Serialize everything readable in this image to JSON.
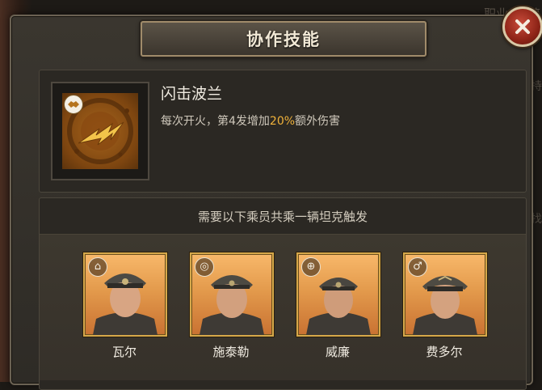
{
  "background": {
    "right_text_1": "职业: 装填",
    "right_text_2": "持",
    "right_text_3": "找"
  },
  "dialog": {
    "title": "协作技能",
    "close_icon": "close-icon"
  },
  "skill": {
    "icon": "lightning-shell-skill-icon",
    "badge_icon": "handshake-icon",
    "name": "闪击波兰",
    "desc_prefix": "每次开火，第4发增加",
    "desc_highlight": "20%",
    "desc_suffix": "额外伤害",
    "highlight_color": "#f0b23a"
  },
  "crew": {
    "title": "需要以下乘员共乘一辆坦克触发",
    "members": [
      {
        "name": "瓦尔",
        "role_icon": "commander-cap-icon"
      },
      {
        "name": "施泰勒",
        "role_icon": "driver-wheel-icon"
      },
      {
        "name": "威廉",
        "role_icon": "gunner-crosshair-icon"
      },
      {
        "name": "费多尔",
        "role_icon": "loader-shell-icon"
      }
    ]
  }
}
